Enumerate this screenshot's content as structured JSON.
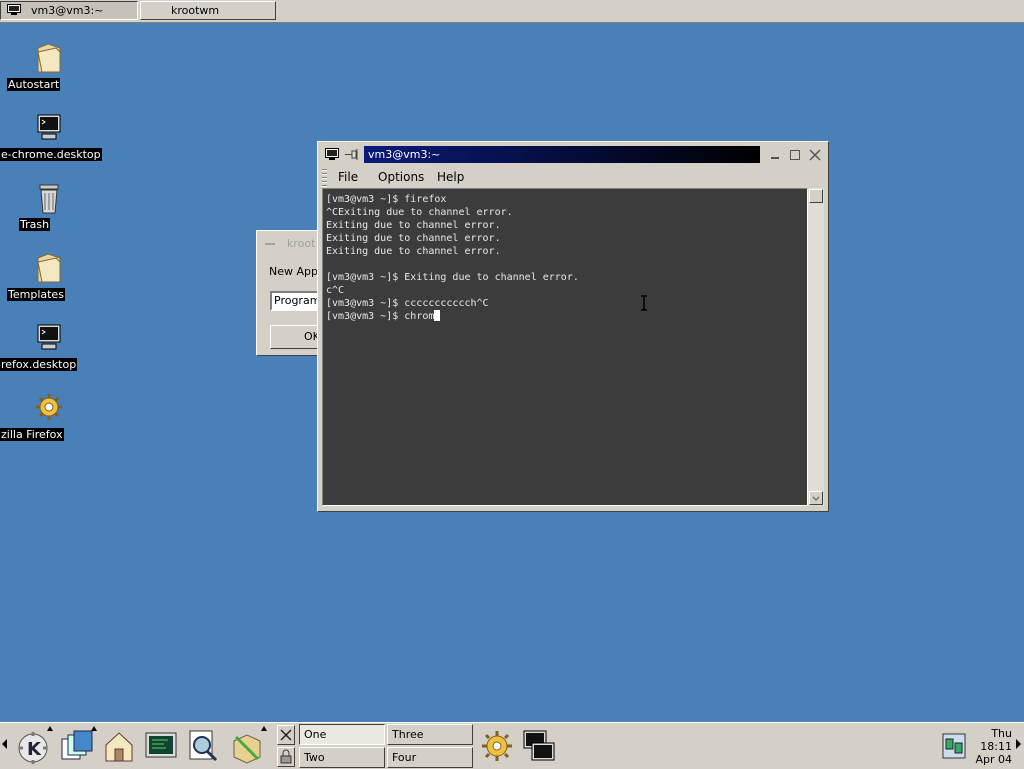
{
  "taskbar": {
    "tasks": [
      {
        "label": "vm3@vm3:~",
        "active": true
      },
      {
        "label": "krootwm",
        "active": false
      }
    ]
  },
  "desktop_icons": [
    {
      "label": "Autostart",
      "icon": "folder-icon"
    },
    {
      "label": "e-chrome.desktop",
      "icon": "terminal-icon"
    },
    {
      "label": "Trash",
      "icon": "trash-icon"
    },
    {
      "label": "Templates",
      "icon": "folder-icon"
    },
    {
      "label": "refox.desktop",
      "icon": "terminal-icon"
    },
    {
      "label": "zilla Firefox",
      "icon": "gear-icon"
    }
  ],
  "dialog": {
    "title": "kroot",
    "label": "New Appl",
    "input_value": "Program",
    "ok_label": "OK"
  },
  "terminal": {
    "title": "vm3@vm3:~",
    "menu": {
      "file": "File",
      "options": "Options",
      "help": "Help"
    },
    "lines": [
      "[vm3@vm3 ~]$ firefox",
      "^CExiting due to channel error.",
      "Exiting due to channel error.",
      "Exiting due to channel error.",
      "Exiting due to channel error.",
      "",
      "[vm3@vm3 ~]$ Exiting due to channel error.",
      "c^C",
      "[vm3@vm3 ~]$ ccccccccccch^C"
    ],
    "prompt": "[vm3@vm3 ~]$ ",
    "current_input": "chrom"
  },
  "panel": {
    "desktops": [
      {
        "label": "One",
        "active": true
      },
      {
        "label": "Three",
        "active": false
      },
      {
        "label": "Two",
        "active": false
      },
      {
        "label": "Four",
        "active": false
      }
    ],
    "clock": {
      "day": "Thu",
      "time": "18:11",
      "date": "Apr 04"
    }
  },
  "colors": {
    "desktop_bg": "#4a80b8",
    "terminal_bg": "#3c3c3c",
    "title_active": "#0a1a7a"
  }
}
